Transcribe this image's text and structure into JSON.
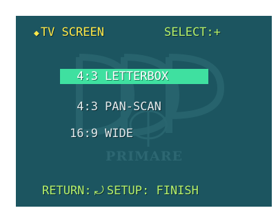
{
  "header": {
    "title_icon": "diamond-icon",
    "title": "TV SCREEN",
    "select_hint": "SELECT:+"
  },
  "menu": {
    "items": [
      {
        "ratio": "4:3",
        "label": "LETTERBOX",
        "selected": true
      },
      {
        "ratio": "4:3",
        "label": "PAN-SCAN",
        "selected": false
      },
      {
        "ratio": "16:9",
        "label": "WIDE",
        "selected": false
      }
    ]
  },
  "footer": {
    "return_label": "RETURN:",
    "return_icon": "return-arrow-icon",
    "setup_label": "SETUP: FINISH"
  },
  "watermark": {
    "text": "PRIMARE"
  },
  "colors": {
    "background": "#1c5560",
    "title": "#ffe94a",
    "hint": "#b6f06a",
    "highlight": "#3fe0a0",
    "text": "#e3ebed"
  }
}
